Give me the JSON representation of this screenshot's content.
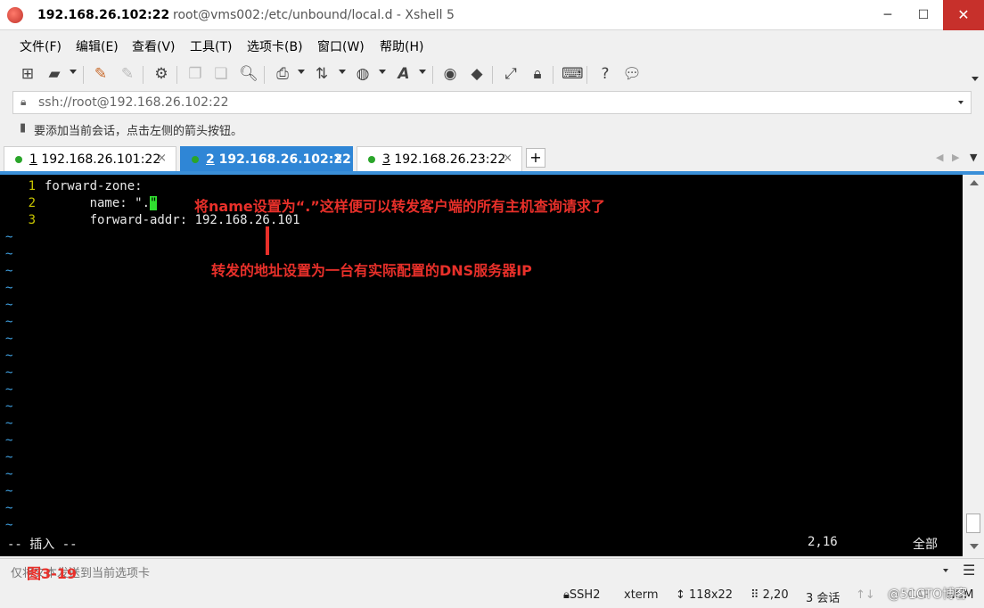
{
  "titlebar": {
    "host": "192.168.26.102:22",
    "path": "root@vms002:/etc/unbound/local.d - Xshell 5",
    "min": "─",
    "max": "☐",
    "close": "✕"
  },
  "menu": [
    "文件(F)",
    "编辑(E)",
    "查看(V)",
    "工具(T)",
    "选项卡(B)",
    "窗口(W)",
    "帮助(H)"
  ],
  "toolbar": {
    "icons": [
      "new-session-icon",
      "open-folder-icon",
      "reconnect-icon",
      "disconnect-icon",
      "properties-icon",
      "copy-icon",
      "paste-icon",
      "find-icon",
      "print-icon",
      "transfer-icon",
      "globe-icon",
      "font-icon",
      "xftp-icon",
      "xagent-icon",
      "fullscreen-icon",
      "lock-icon",
      "keyboard-icon",
      "help-icon",
      "chat-icon"
    ]
  },
  "address": {
    "value": "ssh://root@192.168.26.102:22"
  },
  "hint": {
    "text": "要添加当前会话，点击左侧的箭头按钮。"
  },
  "tabs": [
    {
      "num": "1",
      "label": " 192.168.26.101:22",
      "close": "×",
      "active": false
    },
    {
      "num": "2",
      "label": " 192.168.26.102:22",
      "close": "×",
      "active": true
    },
    {
      "num": "3",
      "label": " 192.168.26.23:22",
      "close": "×",
      "active": false
    }
  ],
  "tab_add": "+",
  "tab_nav": {
    "prev": "◀",
    "next": "▶",
    "menu": "▼"
  },
  "terminal": {
    "lines": [
      {
        "num": "1",
        "text": "forward-zone:"
      },
      {
        "num": "2",
        "text": "      name: \".",
        "cursor": "\""
      },
      {
        "num": "3",
        "text": "      forward-addr: 192.168.26.101"
      }
    ],
    "tilde": "~",
    "status_mode": "-- 插入 --",
    "status_pos": "2,16",
    "status_all": "全部"
  },
  "annotations": {
    "name_note": "将name设置为“.”这样便可以转发客户端的所有主机查询请求了",
    "addr_note": "转发的地址设置为一台有实际配置的DNS服务器IP",
    "figure": "图3-19"
  },
  "sendbar": {
    "text": "仅将文本发送到当前选项卡",
    "menu": "☰"
  },
  "statusbar": {
    "protocol": "SSH2",
    "term": "xterm",
    "size": "118x22",
    "cursor": "2,20",
    "sessions": "3 会话",
    "caps": "CAP",
    "num": "NUM"
  },
  "watermark": "@51CTO博客"
}
